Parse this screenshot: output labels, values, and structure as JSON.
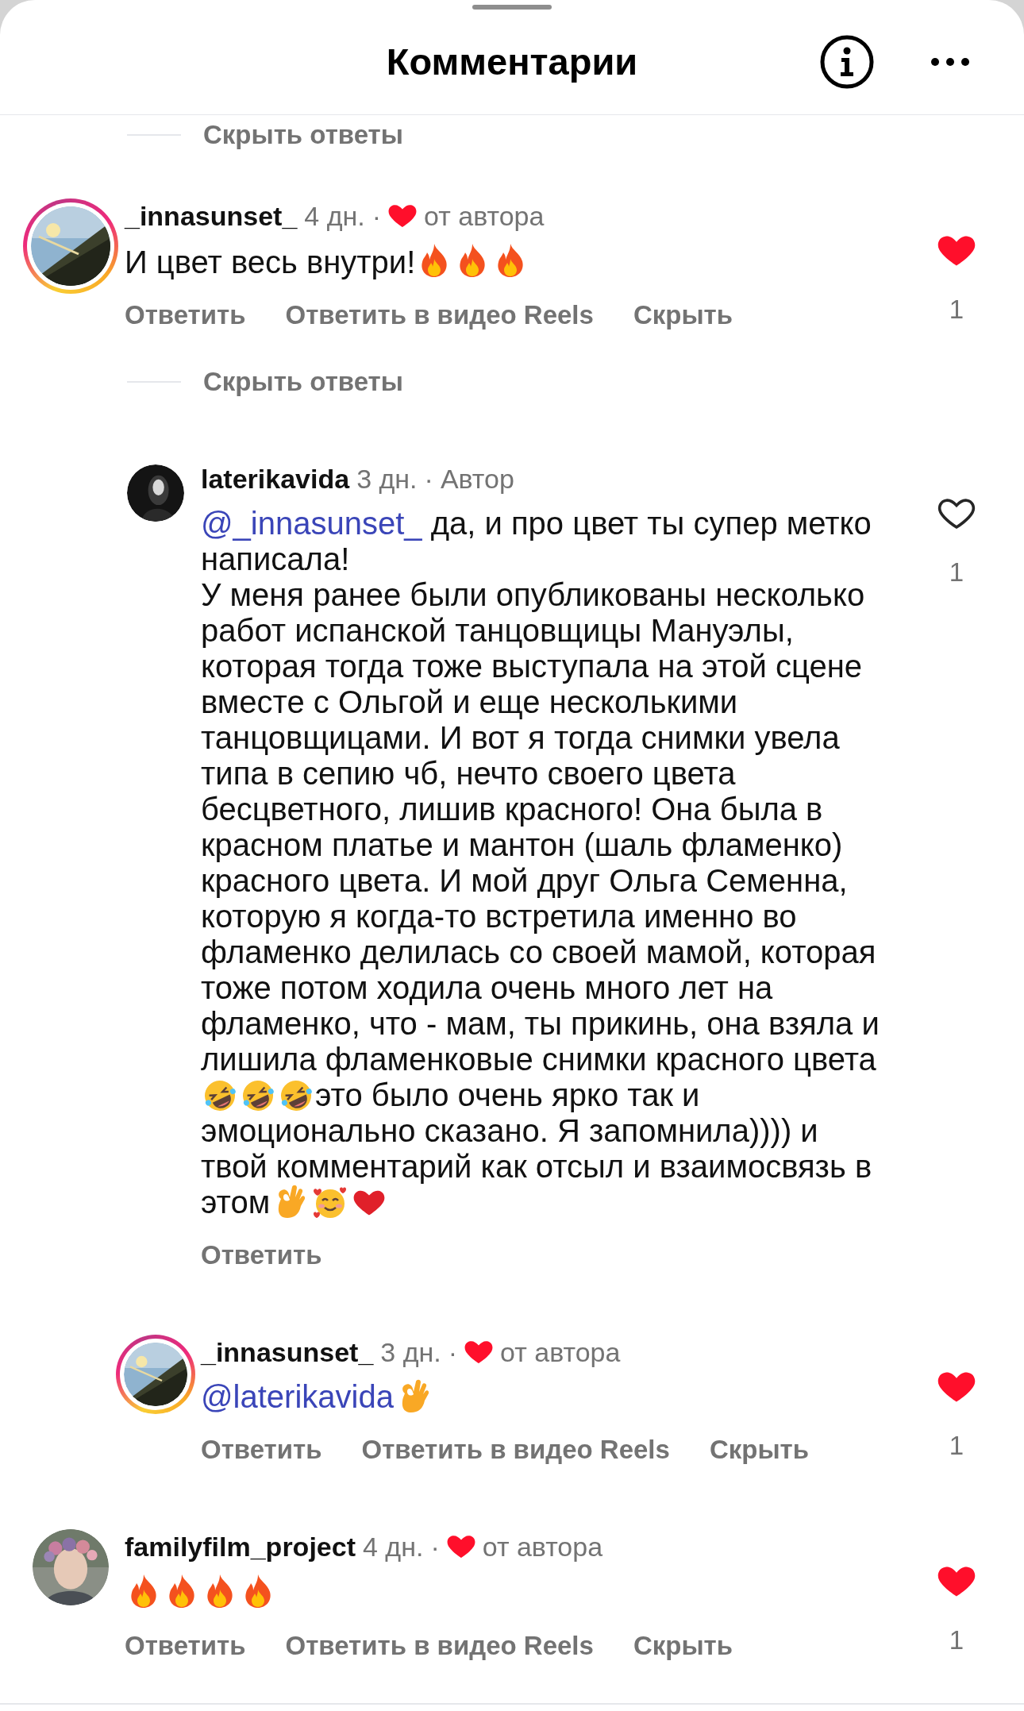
{
  "header": {
    "title": "Комментарии"
  },
  "thread": [
    {
      "kind": "hide_replies",
      "text": "Скрыть ответы"
    },
    {
      "kind": "comment",
      "avatar": {
        "kind": "picture",
        "story_ring": true
      },
      "username": "_innasunset_",
      "time": "4 дн.",
      "separator": "·",
      "badge": {
        "kind": "liked_by_author",
        "text": "от автора"
      },
      "body": [
        [
          {
            "kind": "text",
            "text": "И цвет весь внутри!"
          },
          {
            "kind": "fire"
          },
          {
            "kind": "fire"
          },
          {
            "kind": "fire"
          }
        ]
      ],
      "actions": [
        "Ответить",
        "Ответить в видео Reels",
        "Скрыть"
      ],
      "liked": true,
      "like_count": "1"
    },
    {
      "kind": "hide_replies",
      "text": "Скрыть ответы"
    },
    {
      "kind": "reply",
      "avatar": {
        "kind": "picture",
        "story_ring": false
      },
      "username": "laterikavida",
      "time": "3 дн.",
      "separator": "·",
      "badge": {
        "kind": "author",
        "text": "Автор"
      },
      "body": [
        [
          {
            "kind": "mention",
            "text": "@_innasunset_"
          },
          {
            "kind": "text",
            "text": " да, и про цвет ты супер метко написала!"
          }
        ],
        [
          {
            "kind": "text",
            "text": "У меня ранее были опубликованы несколько работ испанской танцовщицы Мануэлы, которая тогда тоже выступала на этой сцене вместе с Ольгой и еще несколькими танцовщицами. И вот я тогда снимки увела типа в сепию чб, нечто своего цвета бесцветного, лишив красного! Она была в красном платье и мантон (шаль фламенко) красного цвета. И мой друг Ольга Семенна, которую я когда-то встретила именно во фламенко делилась со своей мамой, которая тоже потом ходила очень много лет на фламенко, что - мам, ты прикинь, она взяла и лишила фламенковые снимки красного цвета"
          },
          {
            "kind": "rofl"
          },
          {
            "kind": "rofl"
          },
          {
            "kind": "rofl"
          },
          {
            "kind": "text",
            "text": "это было очень ярко так и эмоционально сказано. Я запомнила)))) и твой комментарий как отсыл и взаимосвязь в этом"
          },
          {
            "kind": "ok_hand"
          },
          {
            "kind": "smiling_hearts"
          },
          {
            "kind": "red_heart"
          }
        ]
      ],
      "actions": [
        "Ответить"
      ],
      "liked": false,
      "like_count": "1"
    },
    {
      "kind": "reply",
      "avatar": {
        "kind": "picture",
        "story_ring": true
      },
      "username": "_innasunset_",
      "time": "3 дн.",
      "separator": "·",
      "badge": {
        "kind": "liked_by_author",
        "text": "от автора"
      },
      "body": [
        [
          {
            "kind": "mention",
            "text": "@laterikavida"
          },
          {
            "kind": "ok_hand"
          }
        ]
      ],
      "actions": [
        "Ответить",
        "Ответить в видео Reels",
        "Скрыть"
      ],
      "liked": true,
      "like_count": "1"
    },
    {
      "kind": "comment",
      "avatar": {
        "kind": "picture",
        "story_ring": false
      },
      "username": "familyfilm_project",
      "time": "4 дн.",
      "separator": "·",
      "badge": {
        "kind": "liked_by_author",
        "text": "от автора"
      },
      "body": [
        [
          {
            "kind": "fire"
          },
          {
            "kind": "fire"
          },
          {
            "kind": "fire"
          },
          {
            "kind": "fire"
          }
        ]
      ],
      "actions": [
        "Ответить",
        "Ответить в видео Reels",
        "Скрыть"
      ],
      "liked": true,
      "like_count": "1"
    }
  ]
}
